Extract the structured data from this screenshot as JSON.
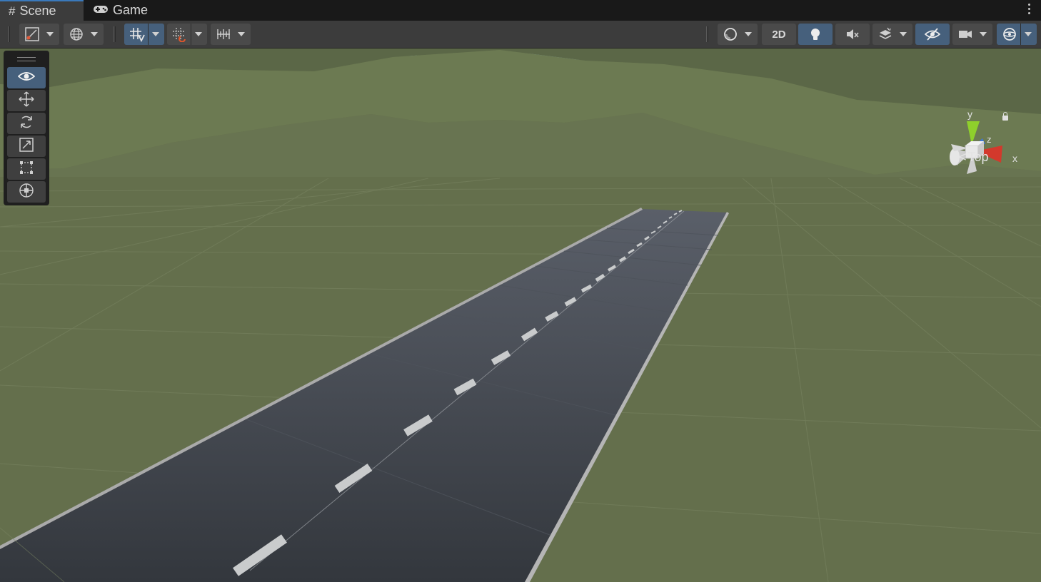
{
  "tabs": [
    {
      "label": "Scene",
      "icon": "hash-icon",
      "active": true
    },
    {
      "label": "Game",
      "icon": "gamepad-icon",
      "active": false
    }
  ],
  "toolbar": {
    "draw_mode_icon": "draw-mode-icon",
    "global_icon": "globe-icon",
    "grid_icon": "grid-snap-icon",
    "increment_snap_icon": "increment-snap-icon",
    "ruler_icon": "ruler-icon",
    "shading_icon": "shading-sphere-icon",
    "two_d_label": "2D",
    "lighting_icon": "lightbulb-icon",
    "audio_icon": "audio-mute-icon",
    "effects_icon": "effects-layers-icon",
    "hidden_icon": "visibility-hidden-icon",
    "camera_icon": "camera-icon",
    "gizmos_icon": "gizmos-icon"
  },
  "tools": [
    {
      "name": "view-tool",
      "icon": "eye-icon",
      "active": true
    },
    {
      "name": "move-tool",
      "icon": "move-arrows-icon",
      "active": false
    },
    {
      "name": "rotate-tool",
      "icon": "rotate-icon",
      "active": false
    },
    {
      "name": "scale-tool",
      "icon": "scale-icon",
      "active": false
    },
    {
      "name": "rect-tool",
      "icon": "rect-transform-icon",
      "active": false
    },
    {
      "name": "transform-tool",
      "icon": "transform-icon",
      "active": false
    }
  ],
  "gizmo": {
    "y_label": "y",
    "z_label": "z",
    "x_label": "x",
    "view_label": "Top"
  },
  "colors": {
    "accent": "#46607c",
    "ground": "#646f4c",
    "road": "#3a3e44",
    "axis_x": "#d3392c",
    "axis_y": "#8fcf2c",
    "axis_z": "#3d78d8"
  }
}
